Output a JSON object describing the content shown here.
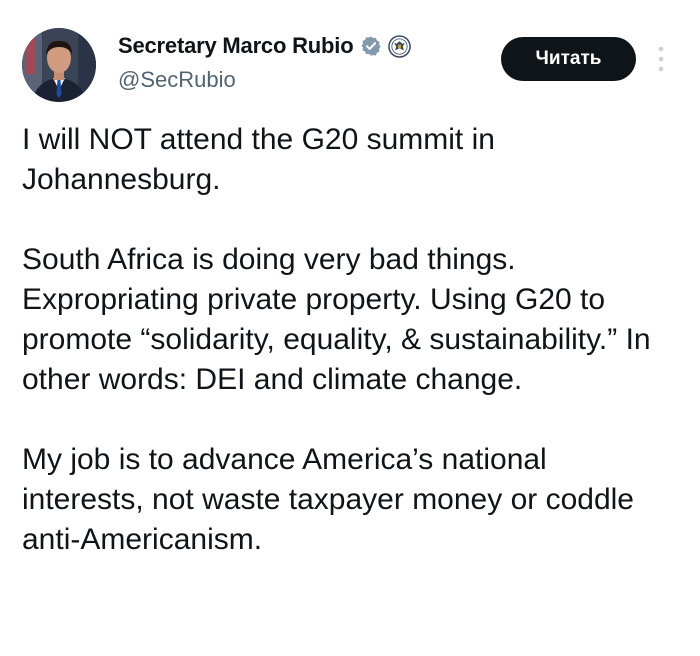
{
  "author": {
    "display_name": "Secretary Marco Rubio",
    "handle": "@SecRubio",
    "verified_icon": "gray-verified-badge-icon",
    "affiliation_icon": "state-department-seal-icon",
    "avatar_icon": "profile-photo-avatar"
  },
  "actions": {
    "follow_label": "Читать",
    "more_icon": "vertical-ellipsis-icon"
  },
  "post": {
    "paragraphs": [
      "I will NOT attend the G20 summit in Johannesburg.",
      "South Africa is doing very bad things. Expropriating private property. Using G20 to promote “solidarity, equality, & sustainability.” In other words: DEI and climate change.",
      "My job is to advance America’s national interests, not waste taxpayer money or coddle anti-Americanism."
    ]
  },
  "colors": {
    "text": "#0f1419",
    "secondary_text": "#536471",
    "button_bg": "#0f1419",
    "button_text": "#ffffff",
    "badge_gray": "#829aab"
  }
}
